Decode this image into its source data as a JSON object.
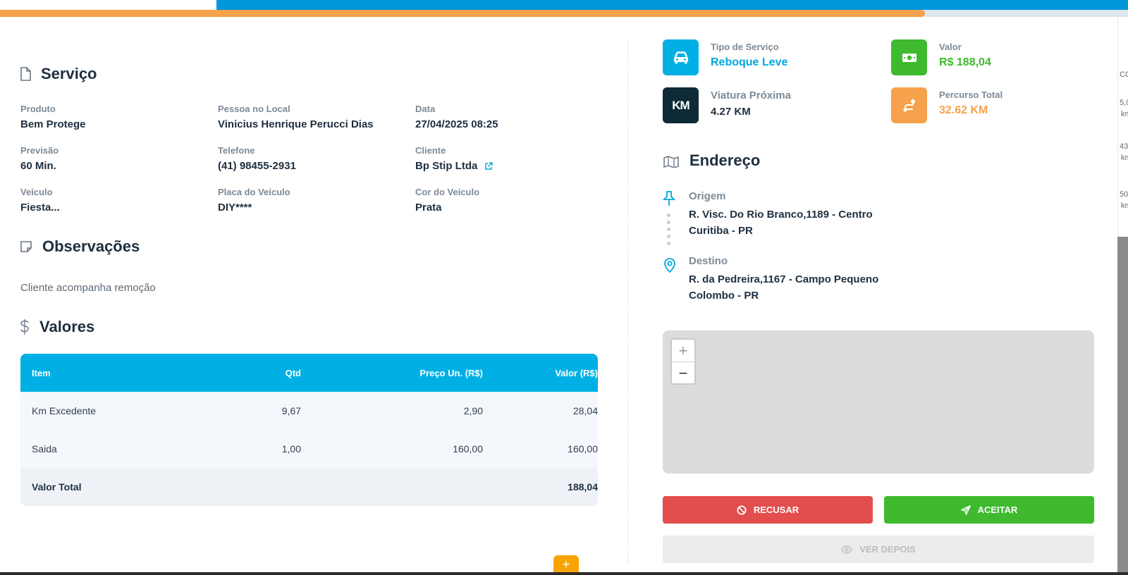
{
  "progress": {
    "fraction": 0.82
  },
  "colors": {
    "accent": "#00b0e5",
    "green": "#3fb92d",
    "orange": "#f6a14b",
    "red": "#e34d4d",
    "dark": "#0f2a37"
  },
  "servico": {
    "title": "Serviço",
    "fields": {
      "produto": {
        "label": "Produto",
        "value": "Bem Protege"
      },
      "pessoa": {
        "label": "Pessoa no Local",
        "value": "Vinicius Henrique Perucci Dias"
      },
      "data": {
        "label": "Data",
        "value": "27/04/2025 08:25"
      },
      "previsao": {
        "label": "Previsão",
        "value": "60 Min."
      },
      "telefone": {
        "label": "Telefone",
        "value": "(41) 98455-2931"
      },
      "cliente": {
        "label": "Cliente",
        "value": "Bp Stip Ltda"
      },
      "veiculo": {
        "label": "Veículo",
        "value": "Fiesta..."
      },
      "placa": {
        "label": "Placa do Veículo",
        "value": "DIY****"
      },
      "cor": {
        "label": "Cor do Veículo",
        "value": "Prata"
      }
    }
  },
  "observacoes": {
    "title": "Observações",
    "text": "Cliente acompanha remoção"
  },
  "valores": {
    "title": "Valores",
    "headers": [
      "Item",
      "Qtd",
      "Preço Un. (R$)",
      "Valor (R$)"
    ],
    "rows": [
      [
        "Km Excedente",
        "9,67",
        "2,90",
        "28,04"
      ],
      [
        "Saida",
        "1,00",
        "160,00",
        "160,00"
      ]
    ],
    "total_label": "Valor Total",
    "total_value": "188,04"
  },
  "info": {
    "tipo": {
      "label": "Tipo de Serviço",
      "value": "Reboque Leve",
      "icon": "car-icon"
    },
    "valor": {
      "label": "Valor",
      "value": "R$ 188,04",
      "icon": "money-icon"
    },
    "viatura": {
      "label": "Viatura Próxima",
      "value": "4.27 KM",
      "badge": "KM"
    },
    "percurso": {
      "label": "Percurso Total",
      "value": "32.62 KM",
      "icon": "route-icon"
    }
  },
  "endereco": {
    "title": "Endereço",
    "origem": {
      "label": "Origem",
      "line1": "R. Visc. Do Rio Branco,1189 - Centro",
      "line2": "Curitiba - PR"
    },
    "destino": {
      "label": "Destino",
      "line1": "R. da Pedreira,1167 - Campo Pequeno",
      "line2": "Colombo - PR"
    }
  },
  "map": {
    "zoom_in": "+",
    "zoom_out": "−"
  },
  "actions": {
    "refuse": "RECUSAR",
    "accept": "ACEITAR",
    "later": "VER DEPOIS"
  },
  "fab": {
    "label": "+"
  },
  "edge_fragments": [
    "CO",
    "5,0",
    "km",
    "43,",
    "km",
    "50,",
    "km"
  ]
}
